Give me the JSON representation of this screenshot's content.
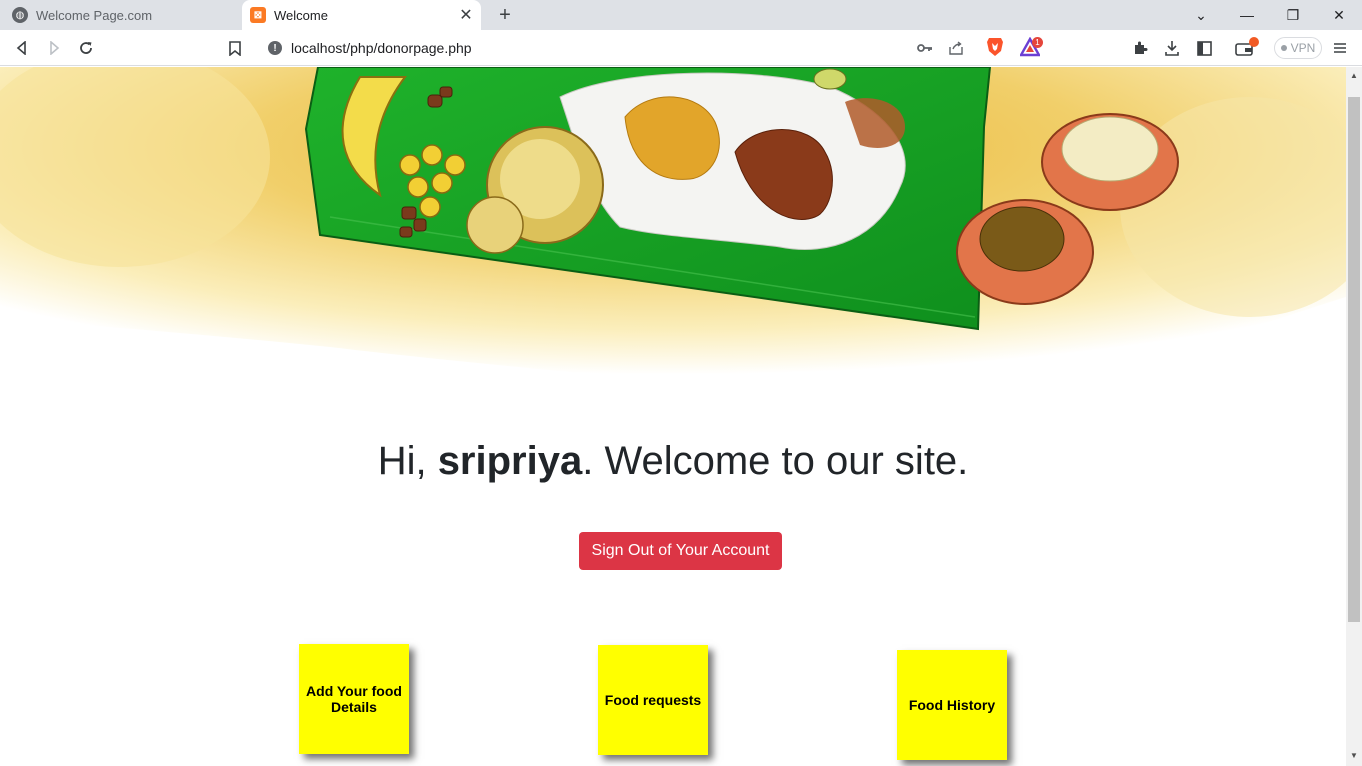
{
  "browser": {
    "tabs": [
      {
        "title": "Welcome Page.com",
        "active": false
      },
      {
        "title": "Welcome",
        "active": true
      }
    ],
    "url": "localhost/php/donorpage.php",
    "vpn_label": "VPN",
    "notification_count": "1"
  },
  "page": {
    "greeting_prefix": "Hi, ",
    "username": "sripriya",
    "greeting_suffix": ". Welcome to our site.",
    "signout_label": "Sign Out of Your Account",
    "cards": [
      {
        "label": "Add Your food Details"
      },
      {
        "label": "Food requests"
      },
      {
        "label": "Food History"
      }
    ]
  },
  "colors": {
    "signout_bg": "#dc3545",
    "note_bg": "#ffff00",
    "leaf": "#1fa52a"
  }
}
